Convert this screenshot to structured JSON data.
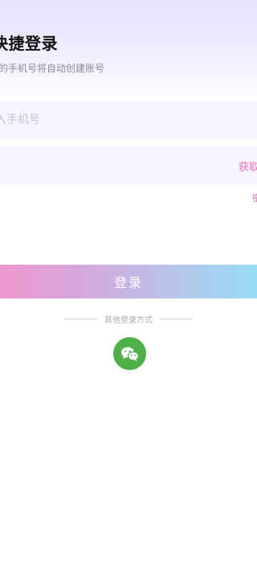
{
  "header": {
    "title": "快捷登录",
    "subtitle": "的手机号将自动创建账号"
  },
  "form": {
    "phone_placeholder": "入手机号",
    "code_placeholder": "",
    "get_code_label": "获取",
    "stray_link_label": "密"
  },
  "login_button_label": "登录",
  "other_login": {
    "label": "其他登录方式",
    "wechat_icon": "wechat-icon"
  },
  "colors": {
    "accent_pink": "#e86fb8",
    "wechat_green": "#4fb04a",
    "button_gradient_start": "#f296cf",
    "button_gradient_end": "#95def6"
  }
}
